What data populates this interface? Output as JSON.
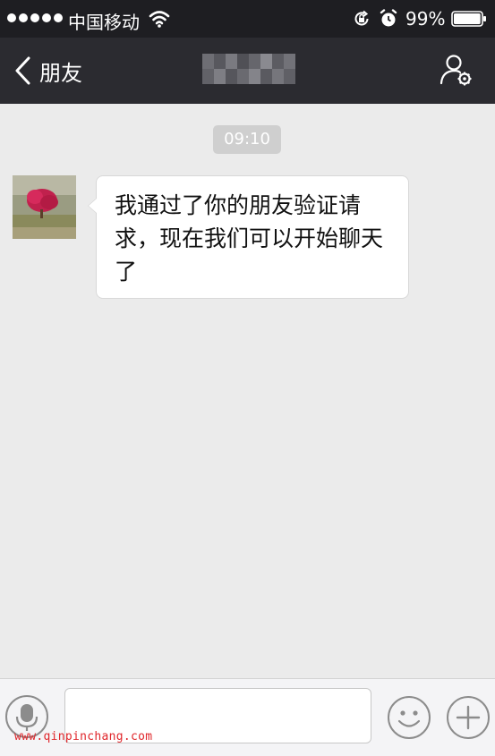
{
  "status_bar": {
    "signal_dots": 5,
    "carrier": "中国移动",
    "battery_percent": "99%",
    "battery_level": 0.99,
    "icons": [
      "wifi-icon",
      "orientation-lock-icon",
      "alarm-icon",
      "battery-icon"
    ]
  },
  "nav_bar": {
    "back_label": "朋友",
    "title_obscured": true,
    "profile_icon": "contact-settings-icon"
  },
  "chat": {
    "time_label": "09:10",
    "messages": [
      {
        "sender": "contact",
        "text": "我通过了你的朋友验证请求，现在我们可以开始聊天了"
      }
    ]
  },
  "input_bar": {
    "value": "",
    "placeholder": "",
    "icons": [
      "microphone-icon",
      "emoji-icon",
      "plus-icon"
    ]
  },
  "watermark": "www.qinpinchang.com",
  "colors": {
    "status_bar_bg": "#1e1e22",
    "nav_bar_bg": "#2b2b30",
    "chat_bg": "#ebebeb",
    "bubble_bg": "#ffffff",
    "time_badge_bg": "#cfcfcf",
    "input_bar_bg": "#f4f4f6",
    "watermark": "#e0262b"
  }
}
